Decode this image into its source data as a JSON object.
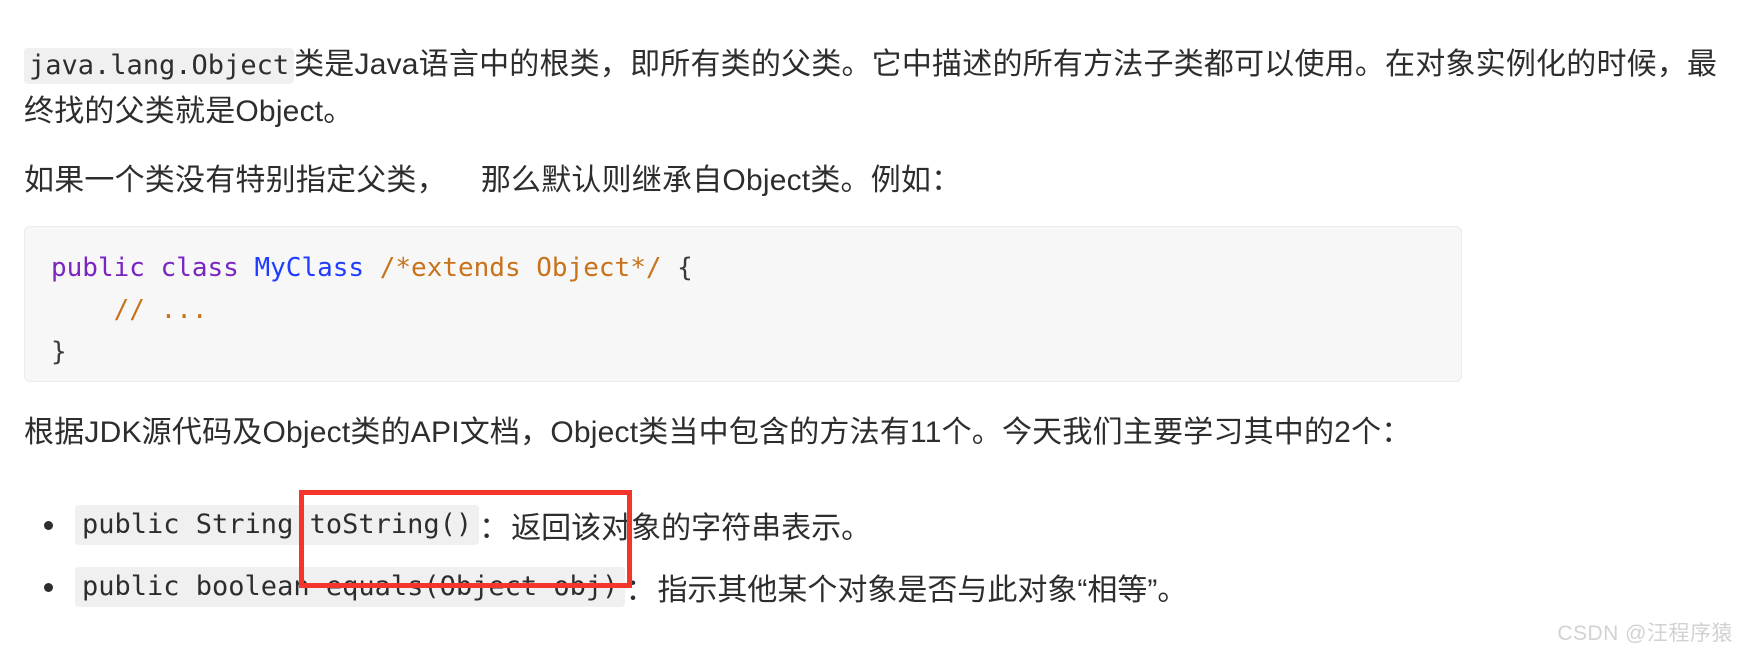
{
  "document": {
    "paragraph_1": {
      "inline_code": "java.lang.Object",
      "text": "类是Java语言中的根类，即所有类的父类。它中描述的所有方法子类都可以使用。在对象实例化的时候，最终找的父类就是Object。"
    },
    "paragraph_2": {
      "part_a": "如果一个类没有特别指定父类，",
      "part_b": "那么默认则继承自Object类。例如："
    },
    "code_block": {
      "line_1": [
        {
          "text": "public class ",
          "token": "keyword"
        },
        {
          "text": "MyClass",
          "token": "type"
        },
        {
          "text": " ",
          "token": "punct"
        },
        {
          "text": "/*extends Object*/",
          "token": "comment"
        },
        {
          "text": " {",
          "token": "punct"
        }
      ],
      "line_2": [
        {
          "text": "    ",
          "token": "punct"
        },
        {
          "text": "// ...",
          "token": "comment"
        }
      ],
      "line_3": [
        {
          "text": "}",
          "token": "punct"
        }
      ],
      "plain_text": "public class MyClass /*extends Object*/ {\n    // ...\n}",
      "language": "java"
    },
    "paragraph_3": {
      "text": "根据JDK源代码及Object类的API文档，Object类当中包含的方法有11个。今天我们主要学习其中的2个："
    },
    "bullets": [
      {
        "code": "public String toString()",
        "separator": "：",
        "description": "返回该对象的字符串表示。"
      },
      {
        "code": "public boolean equals(Object obj)",
        "separator": "：",
        "description": "指示其他某个对象是否与此对象“相等”。"
      }
    ]
  },
  "annotation": {
    "type": "red-rectangle-highlight",
    "color": "#f5342b",
    "covers": "toString() / equals(Object obj)"
  },
  "watermark": {
    "text": "CSDN @汪程序猿"
  },
  "colors": {
    "text": "#2d2d2d",
    "code_keyword": "#7b25c1",
    "code_type": "#1f3cff",
    "code_comment": "#c8721a",
    "code_background": "#f7f7f8",
    "inline_code_background": "#f0f0f0",
    "annotation": "#f5342b",
    "watermark": "#d2d2d2",
    "page_background": "#ffffff"
  }
}
